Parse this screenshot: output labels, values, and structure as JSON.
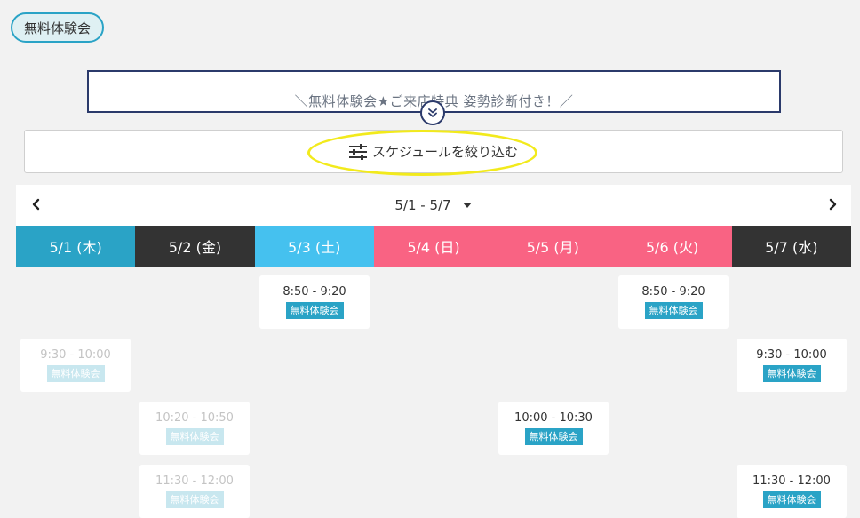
{
  "tag_label": "無料体験会",
  "banner": {
    "text": "＼無料体験会★ご来店特典 姿勢診断付き！／"
  },
  "filter": {
    "label": "スケジュールを絞り込む"
  },
  "week": {
    "range": "5/1 - 5/7"
  },
  "colors": {
    "teal": "#2aa3c6",
    "dark": "#333333",
    "saturday": "#45c1ef",
    "holiday": "#f96383",
    "highlight": "#f2ea1c"
  },
  "days": [
    {
      "label": "5/1 (木)",
      "color": "#2aa3c6"
    },
    {
      "label": "5/2 (金)",
      "color": "#333333"
    },
    {
      "label": "5/3 (土)",
      "color": "#45c1ef"
    },
    {
      "label": "5/4 (日)",
      "color": "#f96383"
    },
    {
      "label": "5/5 (月)",
      "color": "#f96383"
    },
    {
      "label": "5/6 (火)",
      "color": "#f96383"
    },
    {
      "label": "5/7 (水)",
      "color": "#333333"
    }
  ],
  "slots": [
    {
      "day": 2,
      "time": "8:50 - 9:20",
      "label": "無料体験会",
      "available": true
    },
    {
      "day": 5,
      "time": "8:50 - 9:20",
      "label": "無料体験会",
      "available": true
    },
    {
      "day": 0,
      "time": "9:30 - 10:00",
      "label": "無料体験会",
      "available": false
    },
    {
      "day": 6,
      "time": "9:30 - 10:00",
      "label": "無料体験会",
      "available": true
    },
    {
      "day": 1,
      "time": "10:20 - 10:50",
      "label": "無料体験会",
      "available": false
    },
    {
      "day": 4,
      "time": "10:00 - 10:30",
      "label": "無料体験会",
      "available": true
    },
    {
      "day": 1,
      "time": "11:30 - 12:00",
      "label": "無料体験会",
      "available": false
    },
    {
      "day": 6,
      "time": "11:30 - 12:00",
      "label": "無料体験会",
      "available": true
    }
  ]
}
